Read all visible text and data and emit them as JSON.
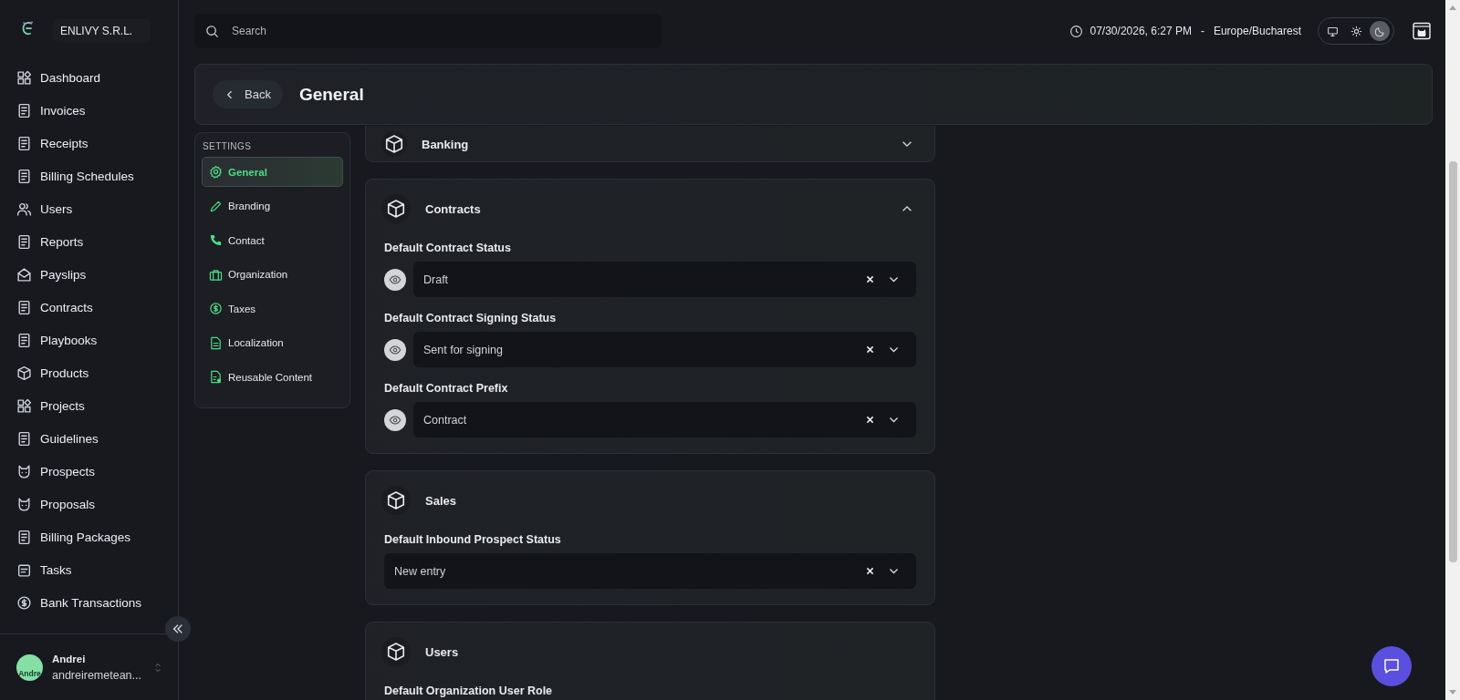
{
  "sidebar": {
    "company": "ENLIVY S.R.L.",
    "items": [
      {
        "label": "Dashboard"
      },
      {
        "label": "Invoices"
      },
      {
        "label": "Receipts"
      },
      {
        "label": "Billing Schedules"
      },
      {
        "label": "Users"
      },
      {
        "label": "Reports"
      },
      {
        "label": "Payslips"
      },
      {
        "label": "Contracts"
      },
      {
        "label": "Playbooks"
      },
      {
        "label": "Products"
      },
      {
        "label": "Projects"
      },
      {
        "label": "Guidelines"
      },
      {
        "label": "Prospects"
      },
      {
        "label": "Proposals"
      },
      {
        "label": "Billing Packages"
      },
      {
        "label": "Tasks"
      },
      {
        "label": "Bank Transactions"
      }
    ],
    "user": {
      "avatar_text": "Andre",
      "name": "Andrei",
      "email": "andreiremetean..."
    }
  },
  "header": {
    "search": {
      "placeholder": "Search"
    },
    "datetime": "07/30/2026, 6:27 PM",
    "separator": "-",
    "timezone": "Europe/Bucharest",
    "theme_options": [
      {
        "kind": "system",
        "selected": false
      },
      {
        "kind": "light",
        "selected": false
      },
      {
        "kind": "dark",
        "selected": true
      }
    ]
  },
  "page": {
    "back": "Back",
    "title": "General"
  },
  "settings_nav": {
    "heading": "SETTINGS",
    "items": [
      {
        "label": "General",
        "selected": true
      },
      {
        "label": "Branding",
        "selected": false
      },
      {
        "label": "Contact",
        "selected": false
      },
      {
        "label": "Organization",
        "selected": false
      },
      {
        "label": "Taxes",
        "selected": false
      },
      {
        "label": "Localization",
        "selected": false
      },
      {
        "label": "Reusable Content",
        "selected": false
      }
    ]
  },
  "sections": [
    {
      "title": "Banking",
      "expanded": false
    },
    {
      "title": "Contracts",
      "expanded": true,
      "fields": [
        {
          "label": "Default Contract Status",
          "kind": "eye-select",
          "value": "Draft"
        },
        {
          "label": "Default Contract Signing Status",
          "kind": "eye-select",
          "value": "Sent for signing"
        },
        {
          "label": "Default Contract Prefix",
          "kind": "eye-select",
          "value": "Contract"
        }
      ]
    },
    {
      "title": "Sales",
      "fields": [
        {
          "label": "Default Inbound Prospect Status",
          "kind": "select",
          "value": "New entry"
        }
      ]
    },
    {
      "title": "Users",
      "fields": [
        {
          "label": "Default Organization User Role",
          "kind": "label"
        }
      ]
    }
  ]
}
